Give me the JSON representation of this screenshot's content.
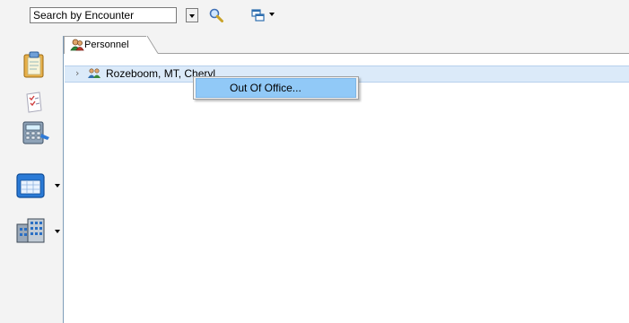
{
  "toolbar": {
    "search_value": "Search by Encounter",
    "icons": [
      "dropdown-icon",
      "search-icon",
      "windows-icon"
    ]
  },
  "tabs": [
    {
      "label": "Personnel",
      "icon": "people-icon",
      "active": true
    }
  ],
  "tree": {
    "rows": [
      {
        "label": "Rozeboom, MT, Cheryl",
        "icon": "group-icon",
        "expanded": false,
        "selected": true
      }
    ]
  },
  "context_menu": {
    "items": [
      {
        "label": "Out Of Office..."
      }
    ]
  },
  "leftnav": {
    "icons": [
      "clipboard-icon",
      "checklist-icon",
      "calculator-icon",
      "calendar-icon",
      "building-icon"
    ]
  },
  "colors": {
    "selection": "#dbeaf9",
    "menu_highlight": "#91c9f7",
    "background": "#f3f3f3"
  }
}
